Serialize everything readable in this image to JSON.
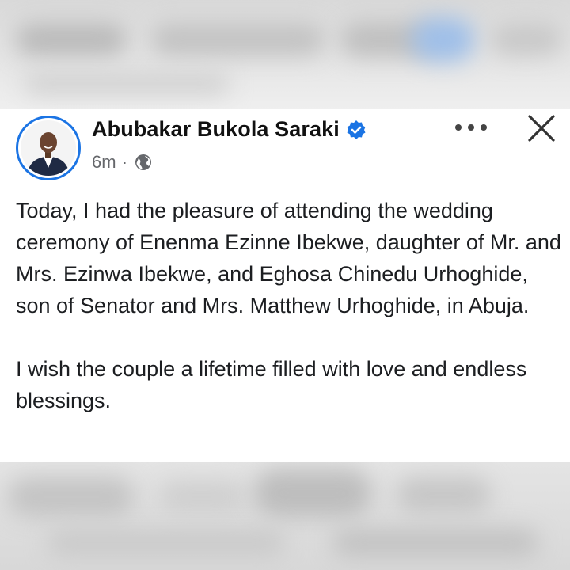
{
  "post": {
    "author": "Abubakar Bukola Saraki",
    "time": "6m",
    "separator": "·",
    "paragraphs": [
      "Today, I had the pleasure of attending the wedding ceremony of Enenma Ezinne Ibekwe, daughter of Mr. and Mrs. Ezinwa Ibekwe, and Eghosa Chinedu Urhoghide, son of Senator and Mrs. Matthew Urhoghide, in Abuja.",
      "I wish the couple a lifetime filled with love and endless blessings."
    ]
  },
  "icons": {
    "verified": "verified-badge-icon",
    "audience": "globe-icon",
    "more": "more-options-icon",
    "close": "close-icon"
  },
  "colors": {
    "accent": "#1b74e4",
    "text": "#1c1e21",
    "meta": "#65676b"
  }
}
